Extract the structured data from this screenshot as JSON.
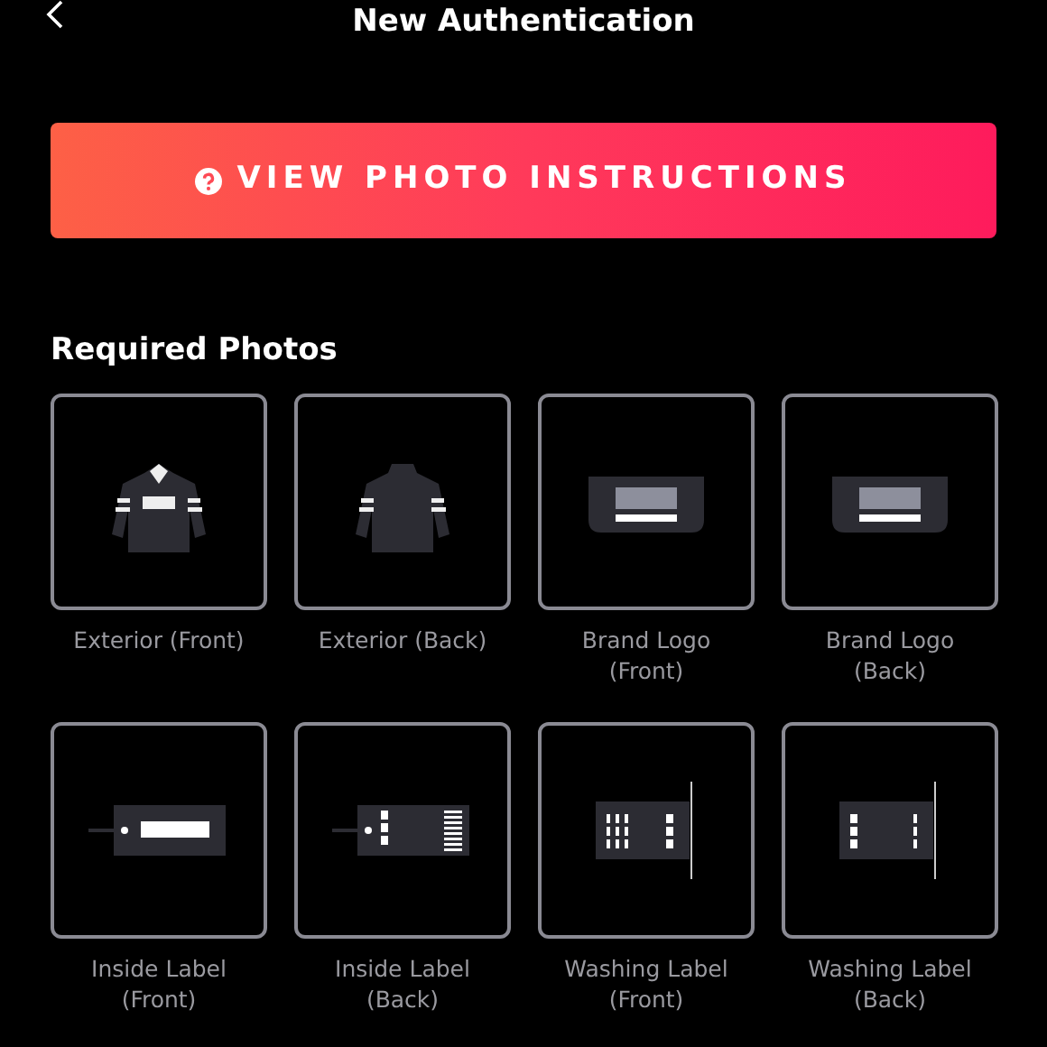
{
  "header": {
    "title": "New Authentication"
  },
  "instructions_button": {
    "label": "VIEW PHOTO INSTRUCTIONS"
  },
  "section_title": "Required Photos",
  "photos": [
    {
      "kind": "jacket-front",
      "label": [
        "Exterior (Front)"
      ]
    },
    {
      "kind": "jacket-back",
      "label": [
        "Exterior (Back)"
      ]
    },
    {
      "kind": "logo",
      "label": [
        "Brand Logo",
        "(Front)"
      ]
    },
    {
      "kind": "logo",
      "label": [
        "Brand Logo",
        "(Back)"
      ]
    },
    {
      "kind": "tag-front",
      "label": [
        "Inside Label",
        "(Front)"
      ]
    },
    {
      "kind": "tag-back",
      "label": [
        "Inside Label",
        "(Back)"
      ]
    },
    {
      "kind": "wash-front",
      "label": [
        "Washing Label",
        "(Front)"
      ]
    },
    {
      "kind": "wash-back",
      "label": [
        "Washing Label",
        "(Back)"
      ]
    }
  ]
}
